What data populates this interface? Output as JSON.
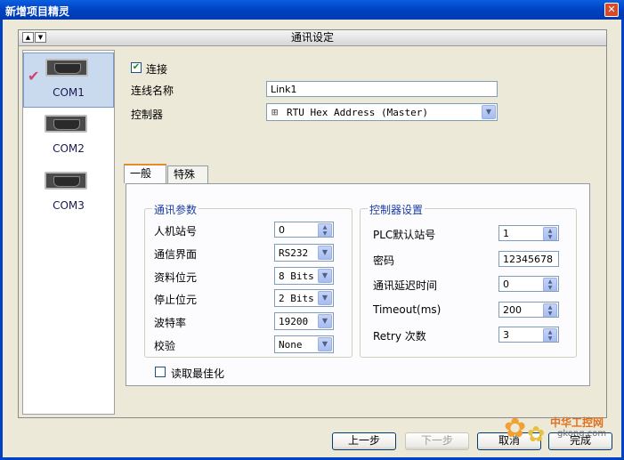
{
  "window": {
    "title": "新增项目精灵",
    "close_glyph": "✕"
  },
  "panel": {
    "header": "通讯设定"
  },
  "com_ports": [
    {
      "label": "COM1",
      "selected": true
    },
    {
      "label": "COM2",
      "selected": false
    },
    {
      "label": "COM3",
      "selected": false
    }
  ],
  "link": {
    "connect_label": "连接",
    "connect_checked": true,
    "name_label": "连线名称",
    "name_value": "Link1",
    "controller_label": "控制器",
    "controller_value": "RTU Hex Address (Master)"
  },
  "tabs": [
    {
      "label": "一般",
      "active": true
    },
    {
      "label": "特殊",
      "active": false
    }
  ],
  "comm_params": {
    "title": "通讯参数",
    "rows": [
      {
        "label": "人机站号",
        "value": "0",
        "type": "spin"
      },
      {
        "label": "通信界面",
        "value": "RS232",
        "type": "combo"
      },
      {
        "label": "资料位元",
        "value": "8 Bits",
        "type": "combo"
      },
      {
        "label": "停止位元",
        "value": "2 Bits",
        "type": "combo"
      },
      {
        "label": "波特率",
        "value": "19200",
        "type": "combo"
      },
      {
        "label": "校验",
        "value": "None",
        "type": "combo"
      }
    ]
  },
  "controller_settings": {
    "title": "控制器设置",
    "rows": [
      {
        "label": "PLC默认站号",
        "value": "1",
        "type": "spin"
      },
      {
        "label": "密码",
        "value": "12345678",
        "type": "text"
      },
      {
        "label": "通讯延迟时间",
        "value": "0",
        "type": "spin"
      },
      {
        "label": "Timeout(ms)",
        "value": "200",
        "type": "spin"
      },
      {
        "label": "Retry 次数",
        "value": "3",
        "type": "spin"
      }
    ]
  },
  "read_optimize": {
    "label": "读取最佳化",
    "checked": false
  },
  "buttons": {
    "prev": "上一步",
    "next": "下一步",
    "cancel": "取消",
    "finish": "完成"
  },
  "watermark": {
    "text": "中华工控网",
    "site": "gkong.com"
  },
  "icons": {
    "checkmark": "✔",
    "arrow_down": "▼",
    "arrow_up": "▲"
  }
}
